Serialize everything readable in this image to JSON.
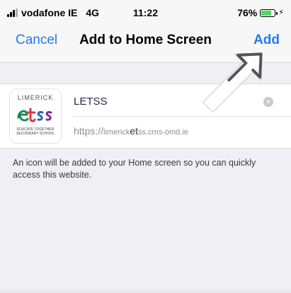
{
  "status": {
    "carrier": "vodafone IE",
    "network": "4G",
    "time": "11:22",
    "battery": "76%",
    "battery_level": 0.76
  },
  "nav": {
    "cancel_label": "Cancel",
    "title": "Add to Home Screen",
    "add_label": "Add"
  },
  "app": {
    "icon_top": "LIMERICK",
    "icon_mark": "etss",
    "icon_bottom_line1": "EDUCATE TOGETHER",
    "icon_bottom_line2": "SECONDARY SCHOOL",
    "name": "LETSS",
    "url_scheme": "https://",
    "url_domain_a": "limerick",
    "url_domain_b": "et",
    "url_domain_c": "ss.cms-omd.ie"
  },
  "info": {
    "text": "An icon will be added to your Home screen so you can quickly access this website."
  },
  "colors": {
    "accent": "#1e7cf6",
    "battery": "#4cd964",
    "background": "#efeff4"
  },
  "icons": [
    "signal-icon",
    "battery-icon",
    "charge-icon",
    "clear-icon",
    "pointer-arrow-icon"
  ]
}
